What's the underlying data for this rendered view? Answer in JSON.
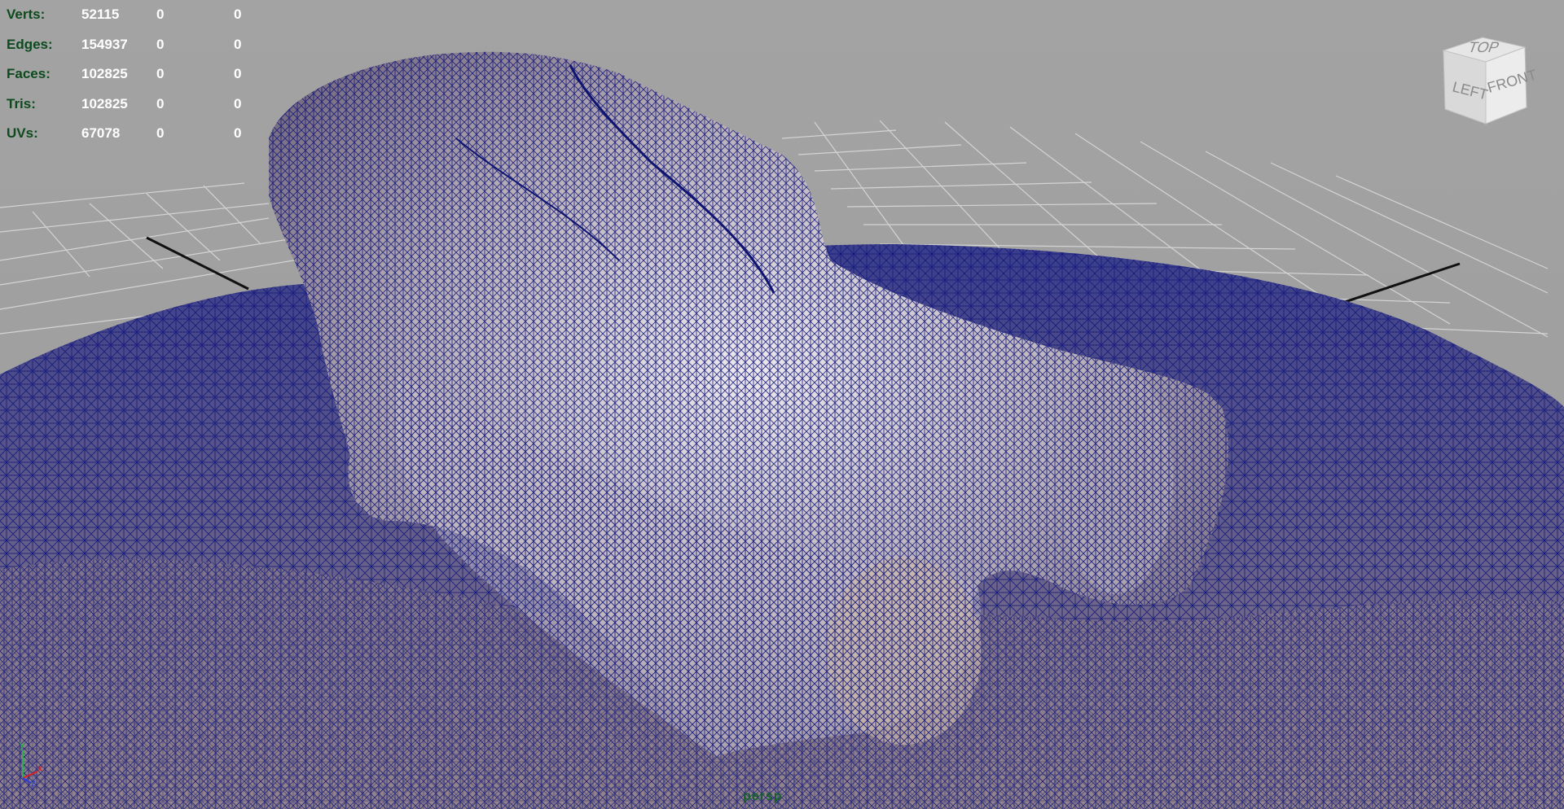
{
  "hud": {
    "rows": [
      {
        "label": "Verts:",
        "v1": "52115",
        "v2": "0",
        "v3": "0"
      },
      {
        "label": "Edges:",
        "v1": "154937",
        "v2": "0",
        "v3": "0"
      },
      {
        "label": "Faces:",
        "v1": "102825",
        "v2": "0",
        "v3": "0"
      },
      {
        "label": "Tris:",
        "v1": "102825",
        "v2": "0",
        "v3": "0"
      },
      {
        "label": "UVs:",
        "v1": "67078",
        "v2": "0",
        "v3": "0"
      }
    ]
  },
  "viewcube": {
    "top_label": "TOP",
    "left_label": "LEFT",
    "front_label": "FRONT"
  },
  "axis": {
    "y": "y",
    "x": "x",
    "z": "z"
  },
  "camera_name": "persp",
  "colors": {
    "hud_label": "#0d4a1e",
    "hud_value": "#ffffff",
    "wireframe": "#1a1f8a",
    "viewport_bg": "#a0a0a0",
    "grid": "#d2d2d2",
    "axis_y": "#27b34a",
    "axis_x": "#d82020",
    "axis_z": "#2a3fd6"
  }
}
